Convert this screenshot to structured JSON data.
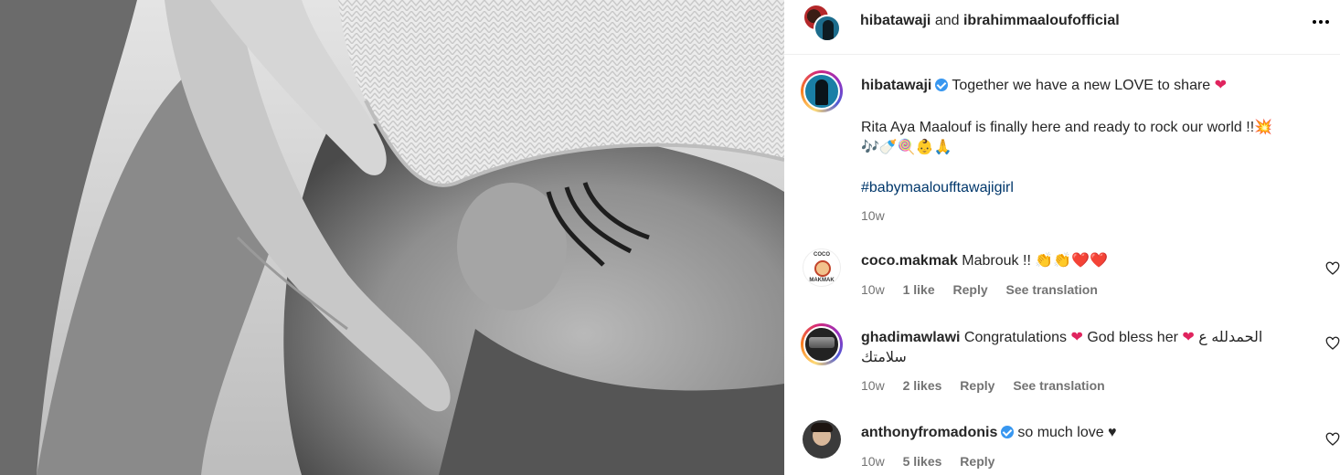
{
  "header": {
    "author1": "hibatawaji",
    "joiner": "and",
    "author2": "ibrahimmaaloufofficial"
  },
  "caption": {
    "username": "hibatawaji",
    "line1": "Together we have a new LOVE to share",
    "line2": "Rita Aya Maalouf is finally here and ready to rock our world !!",
    "emoji_line": "🎶🍼🍭👶🙏",
    "hashtag": "#babymaaloufftawajigirl",
    "time": "10w"
  },
  "comments": [
    {
      "username": "coco.makmak",
      "text": "Mabrouk !!",
      "emojis": "👏👏❤️❤️",
      "time": "10w",
      "likes": "1 like",
      "reply": "Reply",
      "translate": "See translation",
      "avatar_top": "COCO",
      "avatar_bottom": "MAKMAK"
    },
    {
      "username": "ghadimawlawi",
      "text_a": "Congratulations",
      "text_b": "God bless her",
      "text_c": "الحمدلله ع",
      "text_d": "سلامتك",
      "time": "10w",
      "likes": "2 likes",
      "reply": "Reply",
      "translate": "See translation"
    },
    {
      "username": "anthonyfromadonis",
      "text": "so much love ♥",
      "time": "10w",
      "likes": "5 likes",
      "reply": "Reply"
    }
  ],
  "colors": {
    "link": "#00376b",
    "meta_gray": "#737373",
    "verified_blue": "#3897f0"
  },
  "icons": [
    "more-options-icon",
    "verified-badge-icon",
    "heart-icon",
    "red-heart-icon"
  ]
}
